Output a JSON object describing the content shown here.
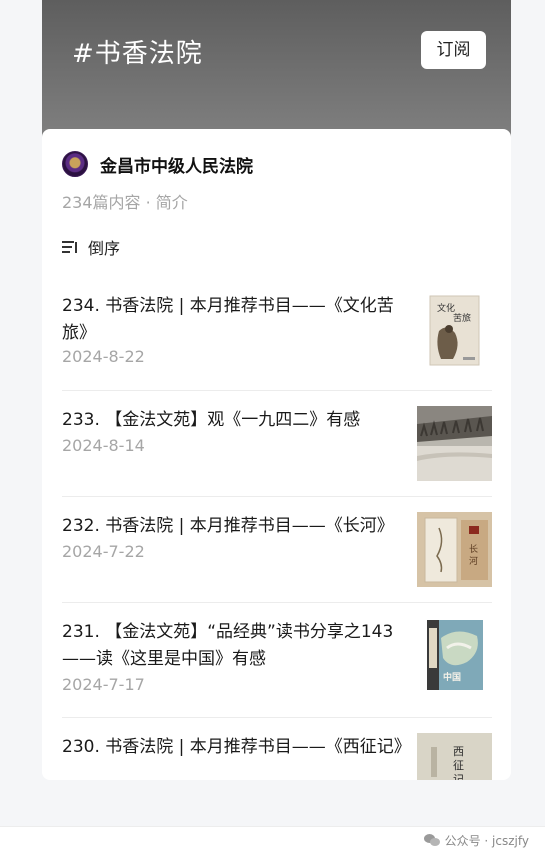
{
  "header": {
    "title": "#书香法院",
    "subscribe_label": "订阅"
  },
  "account": {
    "name": "金昌市中级人民法院",
    "meta": "234篇内容 · 简介",
    "sort_label": "倒序"
  },
  "articles": [
    {
      "title": "234. 书香法院 | 本月推荐书目——《文化苦旅》",
      "date": "2024-8-22",
      "thumb": "book-cover-wenhua-kulv"
    },
    {
      "title": "233. 【金法文苑】观《一九四二》有感",
      "date": "2024-8-14",
      "thumb": "film-still-1942"
    },
    {
      "title": "232. 书香法院 | 本月推荐书目——《长河》",
      "date": "2024-7-22",
      "thumb": "book-cover-changhe"
    },
    {
      "title": "231. 【金法文苑】“品经典”读书分享之143——读《这里是中国》有感",
      "date": "2024-7-17",
      "thumb": "book-cover-zheli-shi-zhongguo"
    },
    {
      "title": "230. 书香法院 | 本月推荐书目——《西征记》",
      "date": "",
      "thumb": "book-cover-xizheng-ji"
    }
  ],
  "footer": {
    "source_label": "公众号 · jcszjfy"
  }
}
